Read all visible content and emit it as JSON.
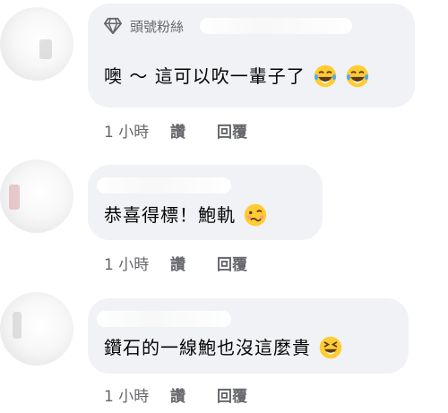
{
  "comments": [
    {
      "badge": "頭號粉絲",
      "text": "噢 ～ 這可以吹一輩子了",
      "emojis": [
        "tears-of-joy-emoji",
        "tears-of-joy-emoji"
      ],
      "time": "1 小時",
      "like": "讚",
      "reply": "回覆"
    },
    {
      "text": "恭喜得標！鮑軌",
      "emojis": [
        "woozy-face-emoji"
      ],
      "time": "1 小時",
      "like": "讚",
      "reply": "回覆"
    },
    {
      "text": "鑽石的一線鮑也沒這麼貴",
      "emojis": [
        "laughing-squinting-emoji"
      ],
      "time": "1 小時",
      "like": "讚",
      "reply": "回覆"
    }
  ],
  "colors": {
    "bubble": "#f0f2f5",
    "meta_text": "#65676b",
    "text": "#050505",
    "emoji_yellow": "#ffcc33"
  }
}
